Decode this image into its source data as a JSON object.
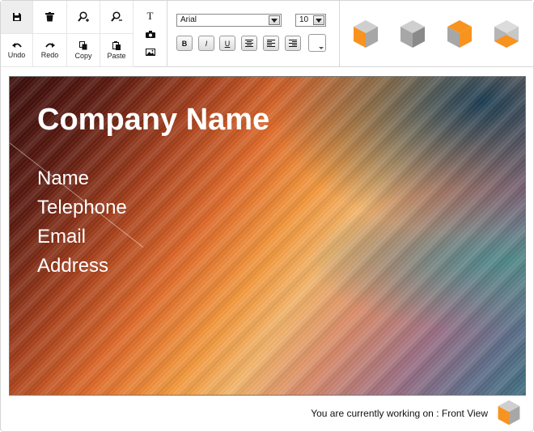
{
  "toolbar": {
    "tools_top": [
      {
        "name": "save-button",
        "icon": "floppy-icon",
        "label": ""
      },
      {
        "name": "delete-button",
        "icon": "trash-icon",
        "label": ""
      },
      {
        "name": "zoom-in-button",
        "icon": "zoom-in-icon",
        "label": ""
      },
      {
        "name": "zoom-out-button",
        "icon": "zoom-out-icon",
        "label": ""
      }
    ],
    "undo_label": "Undo",
    "redo_label": "Redo",
    "copy_label": "Copy",
    "paste_label": "Paste"
  },
  "text_panel": {
    "font_family": "Arial",
    "font_size": "10",
    "bold_label": "B",
    "italic_label": "I",
    "underline_label": "U"
  },
  "canvas": {
    "company_name": "Company Name",
    "fields": [
      "Name",
      "Telephone",
      "Email",
      "Address"
    ]
  },
  "status": {
    "text": "You are currently working on : Front View"
  },
  "colors": {
    "accent": "#f7931e",
    "cube_gray": "#a7a7a7",
    "cube_light": "#cfcfcf",
    "cube_dark": "#8a8a8a"
  }
}
